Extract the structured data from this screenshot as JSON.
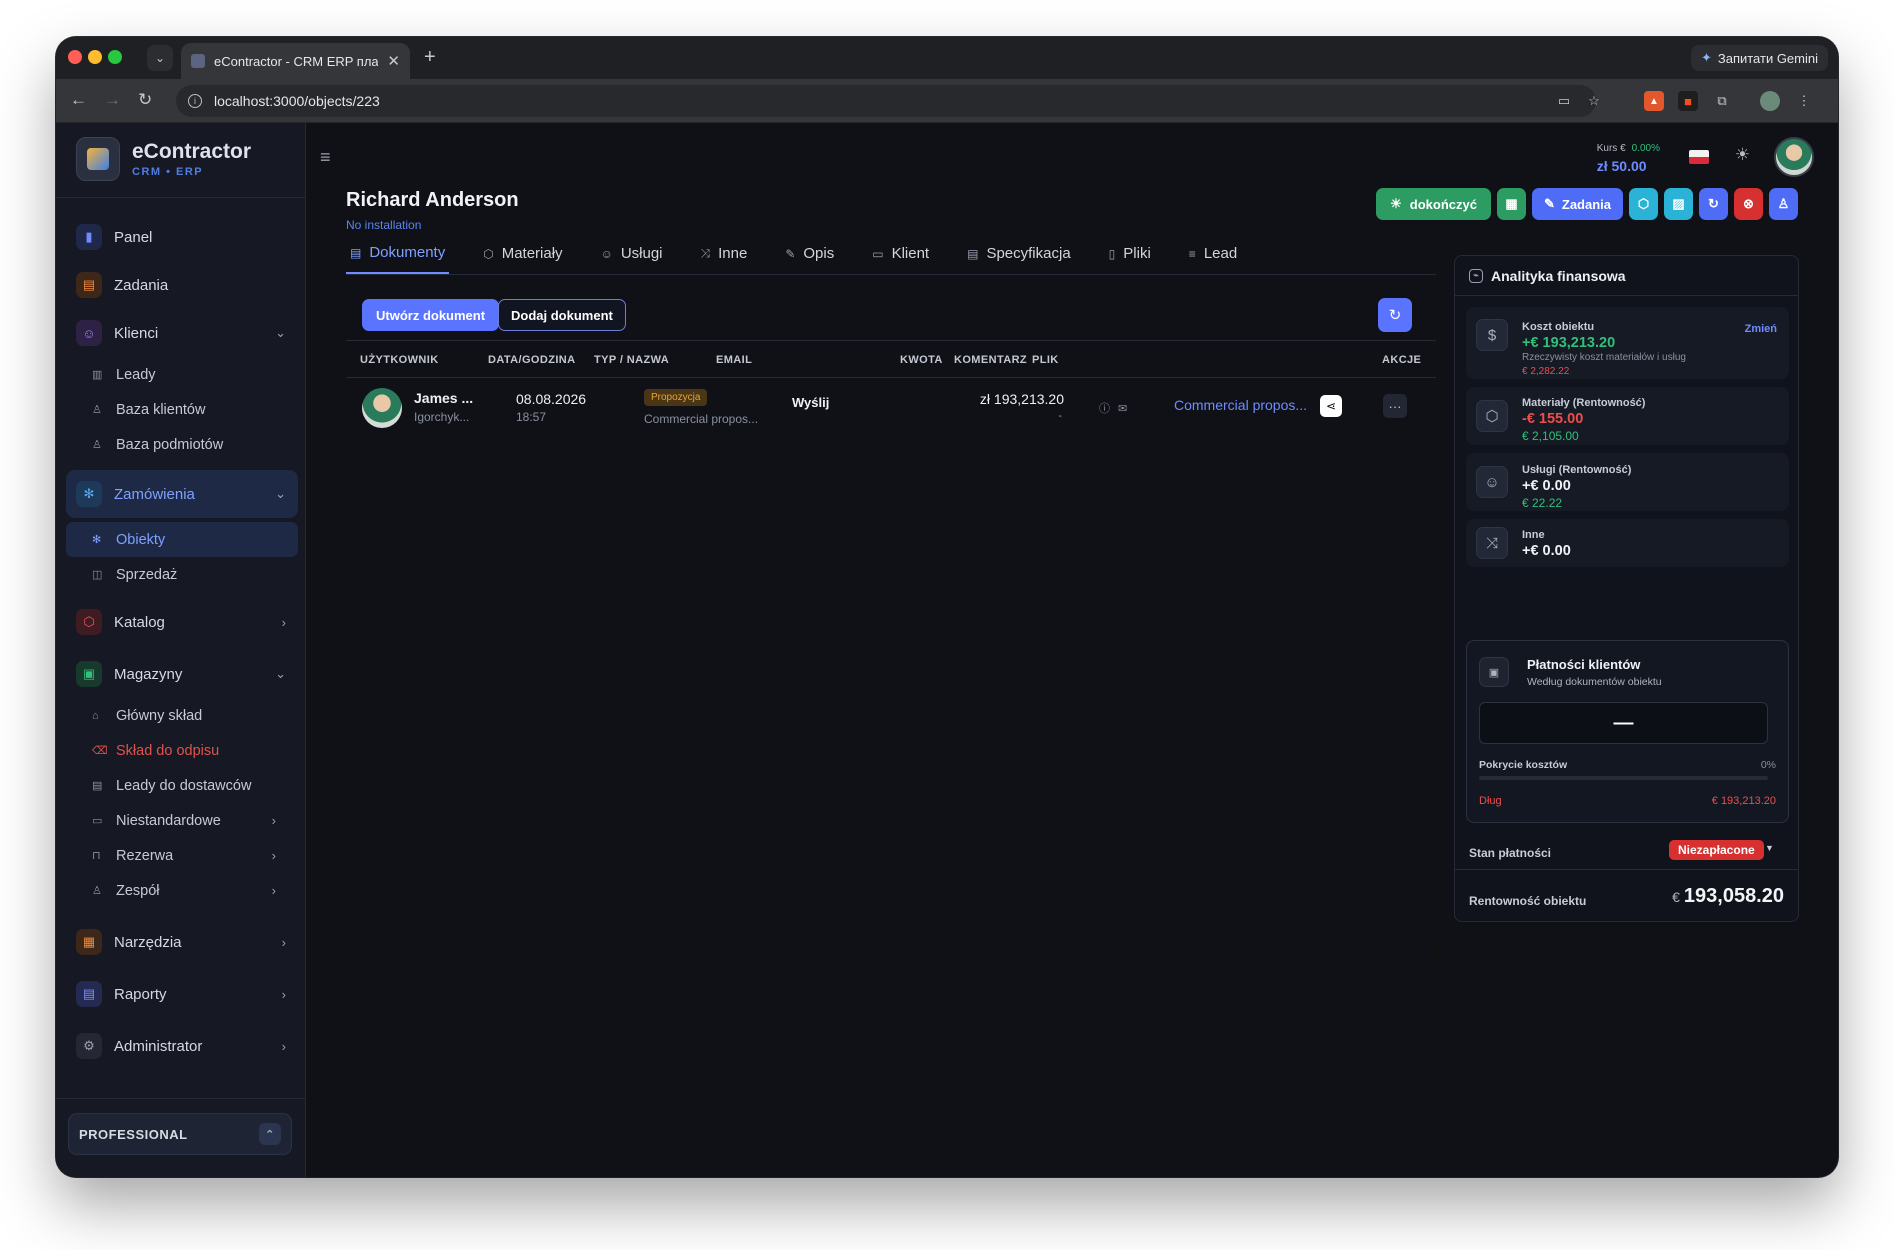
{
  "browser": {
    "tab_title": "eContractor - CRM ERP плат",
    "url": "localhost:3000/objects/223",
    "gemini_label": "Запитати Gemini"
  },
  "brand": {
    "name": "eContractor",
    "sub": "CRM • ERP"
  },
  "sidebar": {
    "items": [
      {
        "label": "Panel",
        "icon": "chart-icon"
      },
      {
        "label": "Zadania",
        "icon": "clipboard-icon"
      },
      {
        "label": "Klienci",
        "icon": "users-icon"
      },
      {
        "label": "Zamówienia",
        "icon": "gear-icon"
      },
      {
        "label": "Katalog",
        "icon": "box-icon"
      },
      {
        "label": "Magazyny",
        "icon": "warehouse-icon"
      },
      {
        "label": "Narzędzia",
        "icon": "briefcase-icon"
      },
      {
        "label": "Raporty",
        "icon": "report-icon"
      },
      {
        "label": "Administrator",
        "icon": "settings-icon"
      }
    ],
    "klienci_sub": [
      "Leady",
      "Baza klientów",
      "Baza podmiotów"
    ],
    "zamowienia_sub": [
      "Obiekty",
      "Sprzedaż"
    ],
    "magazyny_sub": [
      "Główny skład",
      "Skład do odpisu",
      "Leady do dostawców",
      "Niestandardowe",
      "Rezerwa",
      "Zespół"
    ],
    "plan": "PROFESSIONAL"
  },
  "header": {
    "kurs_label": "Kurs €",
    "kurs_pct": "0.00%",
    "kurs_value": "zł 50.00"
  },
  "page": {
    "title": "Richard Anderson",
    "subtitle": "No installation",
    "actions": {
      "finish": "dokończyć",
      "tasks": "Zadania"
    }
  },
  "tabs": [
    "Dokumenty",
    "Materiały",
    "Usługi",
    "Inne",
    "Opis",
    "Klient",
    "Specyfikacja",
    "Pliki",
    "Lead"
  ],
  "buttons": {
    "create": "Utwórz dokument",
    "add": "Dodaj dokument"
  },
  "table": {
    "headers": [
      "UŻYTKOWNIK",
      "DATA/GODZINA",
      "TYP / NAZWA",
      "EMAIL",
      "KWOTA",
      "KOMENTARZ",
      "PLIK",
      "AKCJE"
    ],
    "rows": [
      {
        "user": "James ...",
        "user_sub": "Igorchyk...",
        "date": "08.08.2026",
        "time": "18:57",
        "badge": "Propozycja",
        "doc_name": "Commercial propos...",
        "email": "Wyślij",
        "amount": "zł 193,213.20",
        "amount_sub": "-",
        "file": "Commercial propos..."
      }
    ]
  },
  "finance": {
    "title": "Analityka finansowa",
    "koszt": {
      "label": "Koszt obiektu",
      "value": "+€ 193,213.20",
      "desc": "Rzeczywisty koszt materiałów i usług",
      "real": "€ 2,282.22",
      "change": "Zmień"
    },
    "materialy": {
      "label": "Materiały (Rentowność)",
      "value": "-€ 155.00",
      "sub": "€ 2,105.00"
    },
    "uslugi": {
      "label": "Usługi (Rentowność)",
      "value": "+€ 0.00",
      "sub": "€ 22.22"
    },
    "inne": {
      "label": "Inne",
      "value": "+€ 0.00"
    },
    "payments": {
      "title": "Płatności klientów",
      "subtitle": "Według dokumentów obiektu",
      "box_value": "—",
      "coverage_label": "Pokrycie kosztów",
      "coverage_pct": "0%",
      "coverage_fraction": 0,
      "debt_label": "Dług",
      "debt_value": "€ 193,213.20"
    },
    "status_label": "Stan płatności",
    "status_value": "Niezapłacone",
    "profit_label": "Rentowność obiektu",
    "profit_currency": "€",
    "profit_value": "193,058.20"
  },
  "colors": {
    "accent": "#5b74ff",
    "green": "#30c07a",
    "red": "#ef4c4c",
    "bg": "#0f1117"
  }
}
